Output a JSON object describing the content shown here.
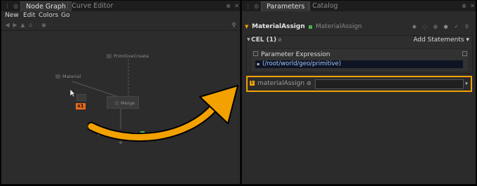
{
  "node_graph_pane": {
    "tabs": [
      {
        "label": "Node Graph",
        "active": true
      },
      {
        "label": "Curve Editor",
        "active": false
      }
    ],
    "menu": [
      "New",
      "Edit",
      "Colors",
      "Go"
    ],
    "nodes": {
      "primitive_create": "PrimitiveCreate",
      "material": "Material",
      "merge": "Merge",
      "material_assign": "MaterialAssign",
      "badge": "x1"
    }
  },
  "parameters_pane": {
    "tabs": [
      {
        "label": "Parameters",
        "active": true
      },
      {
        "label": "Catalog",
        "active": false
      }
    ],
    "node_name": "MaterialAssign",
    "node_type": "MaterialAssign",
    "cel": {
      "title": "CEL (1)",
      "add_statements": "Add Statements",
      "expression_title": "Parameter Expression",
      "expression_value": "(/root/world/geo/primitive)"
    },
    "material_assign": {
      "label": "materialAssign",
      "value": ""
    }
  },
  "colors": {
    "highlight": "#f2a100",
    "arrow": "#f2a100",
    "active_flag": "#4caf50",
    "badge": "#e8691c"
  }
}
